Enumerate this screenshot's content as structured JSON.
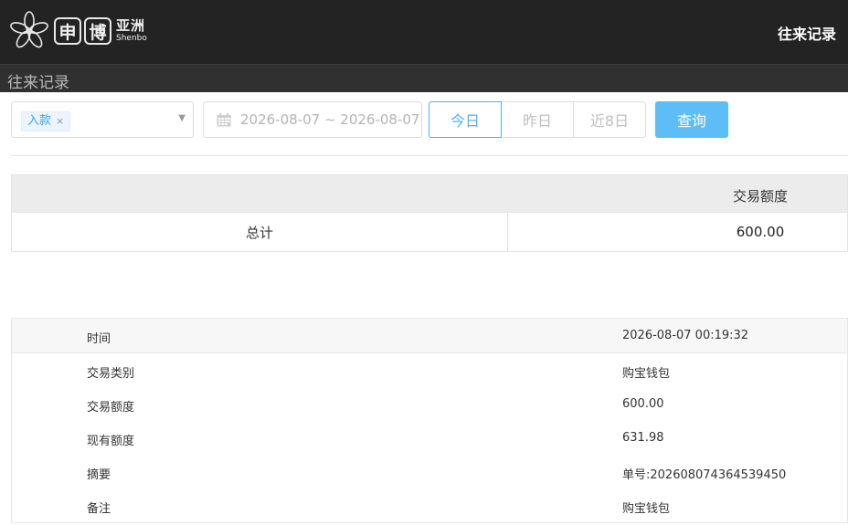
{
  "header": {
    "logo": {
      "char1": "申",
      "char2": "博",
      "cn": "亚洲",
      "en": "Shenbo"
    },
    "title": "往来记录"
  },
  "subbar": {
    "title": "往来记录"
  },
  "filters": {
    "type_tag": "入款",
    "tag_close": "×",
    "date_range": "2026-08-07 ~ 2026-08-07",
    "quick_ranges": [
      "今日",
      "昨日",
      "近8日"
    ],
    "query_label": "查询"
  },
  "summary": {
    "column_header": "交易额度",
    "row_label": "总计",
    "row_value": "600.00"
  },
  "detail": [
    {
      "label": "时间",
      "value": "2026-08-07 00:19:32"
    },
    {
      "label": "交易类别",
      "value": "购宝钱包"
    },
    {
      "label": "交易额度",
      "value": "600.00"
    },
    {
      "label": "现有额度",
      "value": "631.98"
    },
    {
      "label": "摘要",
      "value": "单号:202608074364539450"
    },
    {
      "label": "备注",
      "value": "购宝钱包"
    }
  ],
  "colors": {
    "header_bg": "#232323",
    "accent": "#4db3f5",
    "query_button": "#5cbdf7",
    "tag_text": "#409eff"
  }
}
